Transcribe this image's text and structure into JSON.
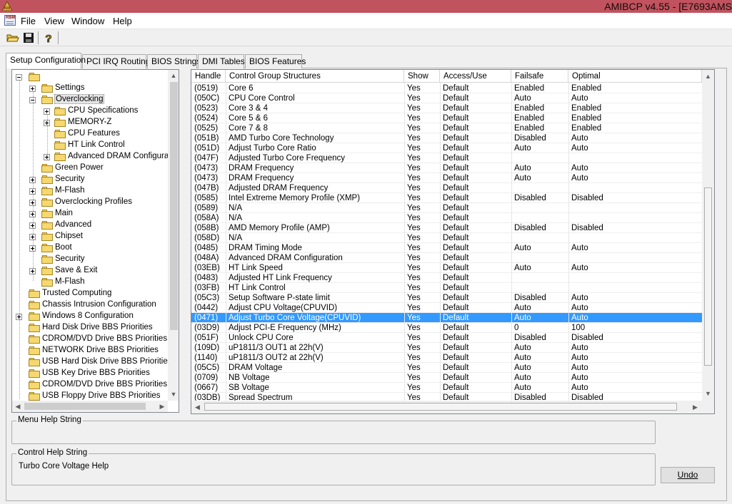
{
  "app": {
    "title": "AMIBCP v4.55 - [E7693AMS",
    "icon_label": "AMI"
  },
  "menu": {
    "items": [
      "File",
      "View",
      "Window",
      "Help"
    ],
    "sys_icon_label": "RBM"
  },
  "toolbar": {
    "icons": [
      "open-folder-icon",
      "save-disk-icon",
      "help-icon"
    ]
  },
  "tabs": [
    {
      "label": "Setup Configuration",
      "active": true
    },
    {
      "label": "PCI IRQ Routing",
      "active": false
    },
    {
      "label": "BIOS Strings",
      "active": false
    },
    {
      "label": "DMI Tables",
      "active": false
    },
    {
      "label": "BIOS Features",
      "active": false
    }
  ],
  "tree": {
    "items": [
      {
        "label": "",
        "level": 0,
        "expander": "minus"
      },
      {
        "label": "Settings",
        "level": 1,
        "expander": "plus"
      },
      {
        "label": "Overclocking",
        "level": 1,
        "expander": "minus",
        "selected": true
      },
      {
        "label": "CPU Specifications",
        "level": 2,
        "expander": "plus"
      },
      {
        "label": "MEMORY-Z",
        "level": 2,
        "expander": "plus"
      },
      {
        "label": "CPU Features",
        "level": 2,
        "expander": "none"
      },
      {
        "label": "HT Link Control",
        "level": 2,
        "expander": "none"
      },
      {
        "label": "Advanced DRAM Configuratio",
        "level": 2,
        "expander": "plus"
      },
      {
        "label": "Green Power",
        "level": 1,
        "expander": "none"
      },
      {
        "label": "Security",
        "level": 1,
        "expander": "plus"
      },
      {
        "label": "M-Flash",
        "level": 1,
        "expander": "plus"
      },
      {
        "label": "Overclocking Profiles",
        "level": 1,
        "expander": "plus"
      },
      {
        "label": "Main",
        "level": 1,
        "expander": "plus"
      },
      {
        "label": "Advanced",
        "level": 1,
        "expander": "plus"
      },
      {
        "label": "Chipset",
        "level": 1,
        "expander": "plus"
      },
      {
        "label": "Boot",
        "level": 1,
        "expander": "plus"
      },
      {
        "label": "Security",
        "level": 1,
        "expander": "none"
      },
      {
        "label": "Save & Exit",
        "level": 1,
        "expander": "plus"
      },
      {
        "label": "M-Flash",
        "level": 1,
        "expander": "none"
      },
      {
        "label": "Trusted Computing",
        "level": 0,
        "expander": "none"
      },
      {
        "label": "Chassis Intrusion Configuration",
        "level": 0,
        "expander": "none"
      },
      {
        "label": "Windows 8 Configuration",
        "level": 0,
        "expander": "plus"
      },
      {
        "label": "Hard Disk Drive BBS Priorities",
        "level": 0,
        "expander": "none"
      },
      {
        "label": "CDROM/DVD Drive BBS Priorities",
        "level": 0,
        "expander": "none"
      },
      {
        "label": "NETWORK Drive BBS Priorities",
        "level": 0,
        "expander": "none"
      },
      {
        "label": "USB Hard Disk Drive BBS Priorities",
        "level": 0,
        "expander": "none"
      },
      {
        "label": "USB Key Drive BBS Priorities",
        "level": 0,
        "expander": "none"
      },
      {
        "label": "CDROM/DVD Drive BBS Priorities",
        "level": 0,
        "expander": "none"
      },
      {
        "label": "USB Floppy Drive BBS Priorities",
        "level": 0,
        "expander": "none"
      }
    ]
  },
  "grid": {
    "columns": [
      "Handle",
      "Control Group Structures",
      "Show",
      "Access/Use",
      "Failsafe",
      "Optimal"
    ],
    "rows": [
      [
        "(0519)",
        "Core 6",
        "Yes",
        "Default",
        "Enabled",
        "Enabled"
      ],
      [
        "(050C)",
        "CPU Core Control",
        "Yes",
        "Default",
        "Auto",
        "Auto"
      ],
      [
        "(0523)",
        "Core 3 & 4",
        "Yes",
        "Default",
        "Enabled",
        "Enabled"
      ],
      [
        "(0524)",
        "Core 5 & 6",
        "Yes",
        "Default",
        "Enabled",
        "Enabled"
      ],
      [
        "(0525)",
        "Core 7 & 8",
        "Yes",
        "Default",
        "Enabled",
        "Enabled"
      ],
      [
        "(051B)",
        "AMD Turbo Core Technology",
        "Yes",
        "Default",
        "Disabled",
        "Auto"
      ],
      [
        "(051D)",
        "Adjust Turbo Core Ratio",
        "Yes",
        "Default",
        "Auto",
        "Auto"
      ],
      [
        "(047F)",
        "Adjusted Turbo Core Frequency",
        "Yes",
        "Default",
        "",
        ""
      ],
      [
        "(0473)",
        "DRAM Frequency",
        "Yes",
        "Default",
        "Auto",
        "Auto"
      ],
      [
        "(0473)",
        "DRAM Frequency",
        "Yes",
        "Default",
        "Auto",
        "Auto"
      ],
      [
        "(047B)",
        "Adjusted DRAM Frequency",
        "Yes",
        "Default",
        "",
        ""
      ],
      [
        "(0585)",
        "Intel Extreme Memory Profile (XMP)",
        "Yes",
        "Default",
        "Disabled",
        "Disabled"
      ],
      [
        "(0589)",
        "N/A",
        "Yes",
        "Default",
        "",
        ""
      ],
      [
        "(058A)",
        "N/A",
        "Yes",
        "Default",
        "",
        ""
      ],
      [
        "(058B)",
        "AMD Memory Profile (AMP)",
        "Yes",
        "Default",
        "Disabled",
        "Disabled"
      ],
      [
        "(058D)",
        "N/A",
        "Yes",
        "Default",
        "",
        ""
      ],
      [
        "(0485)",
        "DRAM Timing Mode",
        "Yes",
        "Default",
        "Auto",
        "Auto"
      ],
      [
        "(048A)",
        "Advanced DRAM Configuration",
        "Yes",
        "Default",
        "",
        ""
      ],
      [
        "(03EB)",
        "HT Link Speed",
        "Yes",
        "Default",
        "Auto",
        "Auto"
      ],
      [
        "(0483)",
        "Adjusted HT Link Frequency",
        "Yes",
        "Default",
        "",
        ""
      ],
      [
        "(03FB)",
        "HT Link Control",
        "Yes",
        "Default",
        "",
        ""
      ],
      [
        "(05C3)",
        "Setup Software P-state limit",
        "Yes",
        "Default",
        "Disabled",
        "Auto"
      ],
      [
        "(0442)",
        "Adjust CPU Voltage(CPUVID)",
        "Yes",
        "Default",
        "Auto",
        "Auto"
      ],
      [
        "(0471)",
        "Adjust Turbo Core Voltage(CPUVID)",
        "Yes",
        "Default",
        "Auto",
        "Auto"
      ],
      [
        "(03D9)",
        "Adjust PCI-E Frequency (MHz)",
        "Yes",
        "Default",
        "0",
        "100"
      ],
      [
        "(051F)",
        "Unlock CPU Core",
        "Yes",
        "Default",
        "Disabled",
        "Disabled"
      ],
      [
        "(109D)",
        "uP1811/3 OUT1 at 22h(V)",
        "Yes",
        "Default",
        "Auto",
        "Auto"
      ],
      [
        "(1140)",
        "uP1811/3 OUT2 at 22h(V)",
        "Yes",
        "Default",
        "Auto",
        "Auto"
      ],
      [
        "(05C5)",
        "DRAM Voltage",
        "Yes",
        "Default",
        "Auto",
        "Auto"
      ],
      [
        "(0709)",
        "NB Voltage",
        "Yes",
        "Default",
        "Auto",
        "Auto"
      ],
      [
        "(0667)",
        "SB Voltage",
        "Yes",
        "Default",
        "Auto",
        "Auto"
      ],
      [
        "(03DB)",
        "Spread Spectrum",
        "Yes",
        "Default",
        "Disabled",
        "Disabled"
      ]
    ],
    "selected_row": 23
  },
  "menu_help": {
    "label": "Menu Help String",
    "text": ""
  },
  "control_help": {
    "label": "Control Help String",
    "text": "Turbo Core Voltage Help"
  },
  "buttons": {
    "undo": "Undo"
  },
  "colors": {
    "titlebar": "#c0535e",
    "selection": "#3399ff",
    "folder": "#f5d86f"
  }
}
